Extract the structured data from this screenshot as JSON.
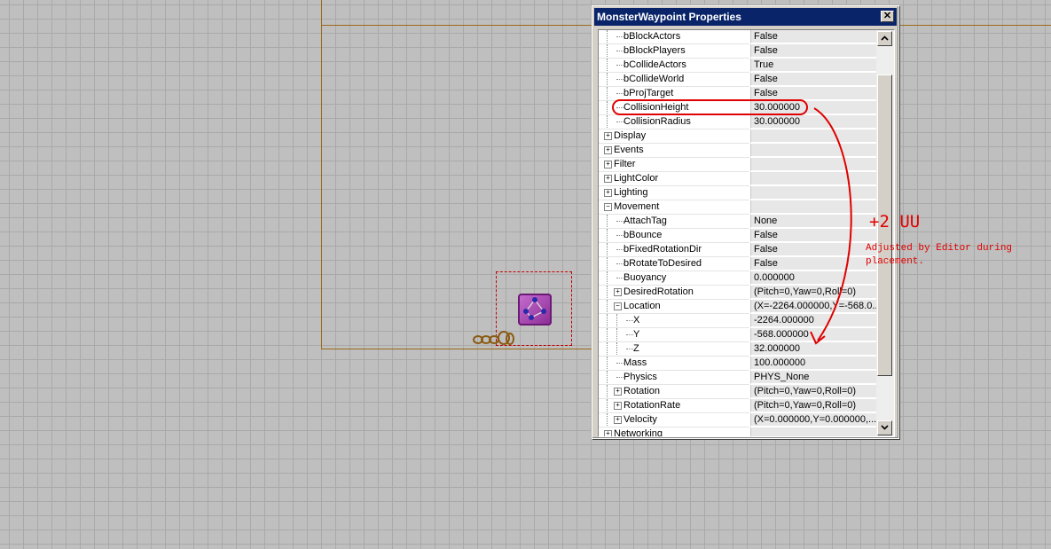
{
  "window": {
    "title": "MonsterWaypoint Properties",
    "close_label": "✕"
  },
  "properties": [
    {
      "name": "bBlockActors",
      "value": "False",
      "level": 2,
      "expander": null
    },
    {
      "name": "bBlockPlayers",
      "value": "False",
      "level": 2,
      "expander": null
    },
    {
      "name": "bCollideActors",
      "value": "True",
      "level": 2,
      "expander": null
    },
    {
      "name": "bCollideWorld",
      "value": "False",
      "level": 2,
      "expander": null
    },
    {
      "name": "bProjTarget",
      "value": "False",
      "level": 2,
      "expander": null
    },
    {
      "name": "CollisionHeight",
      "value": "30.000000",
      "level": 2,
      "expander": null
    },
    {
      "name": "CollisionRadius",
      "value": "30.000000",
      "level": 2,
      "expander": null
    },
    {
      "name": "Display",
      "value": "",
      "level": 1,
      "expander": "+"
    },
    {
      "name": "Events",
      "value": "",
      "level": 1,
      "expander": "+"
    },
    {
      "name": "Filter",
      "value": "",
      "level": 1,
      "expander": "+"
    },
    {
      "name": "LightColor",
      "value": "",
      "level": 1,
      "expander": "+"
    },
    {
      "name": "Lighting",
      "value": "",
      "level": 1,
      "expander": "+"
    },
    {
      "name": "Movement",
      "value": "",
      "level": 1,
      "expander": "−"
    },
    {
      "name": "AttachTag",
      "value": "None",
      "level": 2,
      "expander": null
    },
    {
      "name": "bBounce",
      "value": "False",
      "level": 2,
      "expander": null
    },
    {
      "name": "bFixedRotationDir",
      "value": "False",
      "level": 2,
      "expander": null
    },
    {
      "name": "bRotateToDesired",
      "value": "False",
      "level": 2,
      "expander": null
    },
    {
      "name": "Buoyancy",
      "value": "0.000000",
      "level": 2,
      "expander": null
    },
    {
      "name": "DesiredRotation",
      "value": "(Pitch=0,Yaw=0,Roll=0)",
      "level": 2,
      "expander": "+"
    },
    {
      "name": "Location",
      "value": "(X=-2264.000000,Y=-568.0...",
      "level": 2,
      "expander": "−"
    },
    {
      "name": "X",
      "value": "-2264.000000",
      "level": 3,
      "expander": null
    },
    {
      "name": "Y",
      "value": "-568.000000",
      "level": 3,
      "expander": null
    },
    {
      "name": "Z",
      "value": "32.000000",
      "level": 3,
      "expander": null
    },
    {
      "name": "Mass",
      "value": "100.000000",
      "level": 2,
      "expander": null
    },
    {
      "name": "Physics",
      "value": "PHYS_None",
      "level": 2,
      "expander": null
    },
    {
      "name": "Rotation",
      "value": "(Pitch=0,Yaw=0,Roll=0)",
      "level": 2,
      "expander": "+"
    },
    {
      "name": "RotationRate",
      "value": "(Pitch=0,Yaw=0,Roll=0)",
      "level": 2,
      "expander": "+"
    },
    {
      "name": "Velocity",
      "value": "(X=0.000000,Y=0.000000,...",
      "level": 2,
      "expander": "+"
    },
    {
      "name": "Networking",
      "value": "",
      "level": 1,
      "expander": "+"
    }
  ],
  "annotation": {
    "delta": "+2 UU",
    "note": "Adjusted by Editor during placement.",
    "color": "#e00000"
  },
  "icons": {
    "waypoint": "monster-waypoint-icon",
    "chain": "chain-actor-icon"
  }
}
